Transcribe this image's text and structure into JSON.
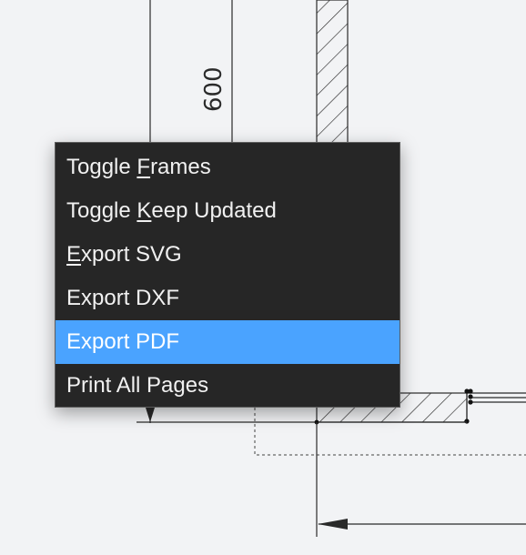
{
  "drawing": {
    "dimension_label": "600"
  },
  "menu": {
    "items": [
      {
        "before": "Toggle ",
        "mnemonic": "F",
        "after": "rames",
        "selected": false
      },
      {
        "before": "Toggle ",
        "mnemonic": "K",
        "after": "eep Updated",
        "selected": false
      },
      {
        "before": "",
        "mnemonic": "E",
        "after": "xport SVG",
        "selected": false
      },
      {
        "before": "Export DXF",
        "mnemonic": "",
        "after": "",
        "selected": false
      },
      {
        "before": "Export PDF",
        "mnemonic": "",
        "after": "",
        "selected": true
      },
      {
        "before": "Print All Pages",
        "mnemonic": "",
        "after": "",
        "selected": false
      }
    ]
  },
  "colors": {
    "canvas_bg": "#f2f3f5",
    "menu_bg": "#262626",
    "menu_text": "#f1f1f1",
    "selection": "#4aa3ff",
    "line": "#2a2a2a"
  }
}
